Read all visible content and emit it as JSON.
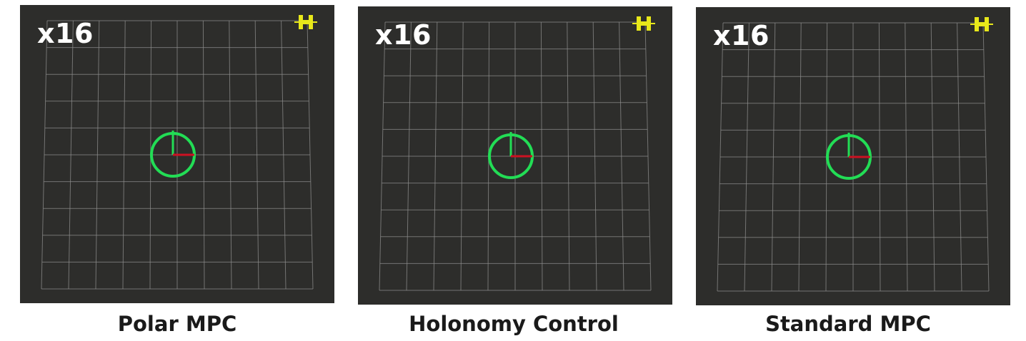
{
  "panels": [
    {
      "speed_label": "x16",
      "caption": "Polar MPC"
    },
    {
      "speed_label": "x16",
      "caption": "Holonomy Control"
    },
    {
      "speed_label": "x16",
      "caption": "Standard MPC"
    }
  ],
  "icons": {
    "robot": "robot-circle-icon",
    "satellite": "satellite-icon"
  },
  "colors": {
    "background": "#2d2d2b",
    "grid": "#8c8c8c",
    "robot_ring": "#22dd55",
    "heading_axis": "#22dd55",
    "x_axis": "#cc1122",
    "satellite": "#e8e81a"
  }
}
